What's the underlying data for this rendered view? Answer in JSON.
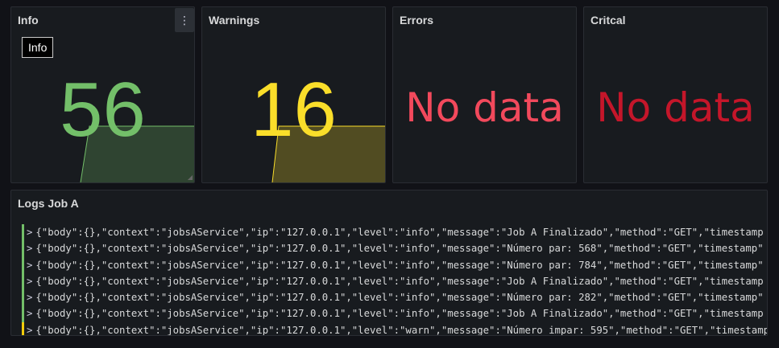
{
  "panels": {
    "info": {
      "title": "Info",
      "value": "56",
      "tooltip": "Info",
      "menu_icon": "⋮",
      "color": "#73bf69"
    },
    "warnings": {
      "title": "Warnings",
      "value": "16",
      "color": "#fade2a"
    },
    "errors": {
      "title": "Errors",
      "value": "No data",
      "color": "#f2495c"
    },
    "critical": {
      "title": "Critcal",
      "value": "No data",
      "color": "#c4162a"
    }
  },
  "logs": {
    "title": "Logs Job A",
    "expand_icon": ">",
    "lines": [
      {
        "level": "info",
        "text": "{\"body\":{},\"context\":\"jobsAService\",\"ip\":\"127.0.0.1\",\"level\":\"info\",\"message\":\"Job A Finalizado\",\"method\":\"GET\",\"timestamp"
      },
      {
        "level": "info",
        "text": "{\"body\":{},\"context\":\"jobsAService\",\"ip\":\"127.0.0.1\",\"level\":\"info\",\"message\":\"Número par: 568\",\"method\":\"GET\",\"timestamp\""
      },
      {
        "level": "info",
        "text": "{\"body\":{},\"context\":\"jobsAService\",\"ip\":\"127.0.0.1\",\"level\":\"info\",\"message\":\"Número par: 784\",\"method\":\"GET\",\"timestamp\""
      },
      {
        "level": "info",
        "text": "{\"body\":{},\"context\":\"jobsAService\",\"ip\":\"127.0.0.1\",\"level\":\"info\",\"message\":\"Job A Finalizado\",\"method\":\"GET\",\"timestamp"
      },
      {
        "level": "info",
        "text": "{\"body\":{},\"context\":\"jobsAService\",\"ip\":\"127.0.0.1\",\"level\":\"info\",\"message\":\"Número par: 282\",\"method\":\"GET\",\"timestamp\""
      },
      {
        "level": "info",
        "text": "{\"body\":{},\"context\":\"jobsAService\",\"ip\":\"127.0.0.1\",\"level\":\"info\",\"message\":\"Job A Finalizado\",\"method\":\"GET\",\"timestamp"
      },
      {
        "level": "warn",
        "text": "{\"body\":{},\"context\":\"jobsAService\",\"ip\":\"127.0.0.1\",\"level\":\"warn\",\"message\":\"Número impar: 595\",\"method\":\"GET\",\"timestamp"
      }
    ]
  }
}
